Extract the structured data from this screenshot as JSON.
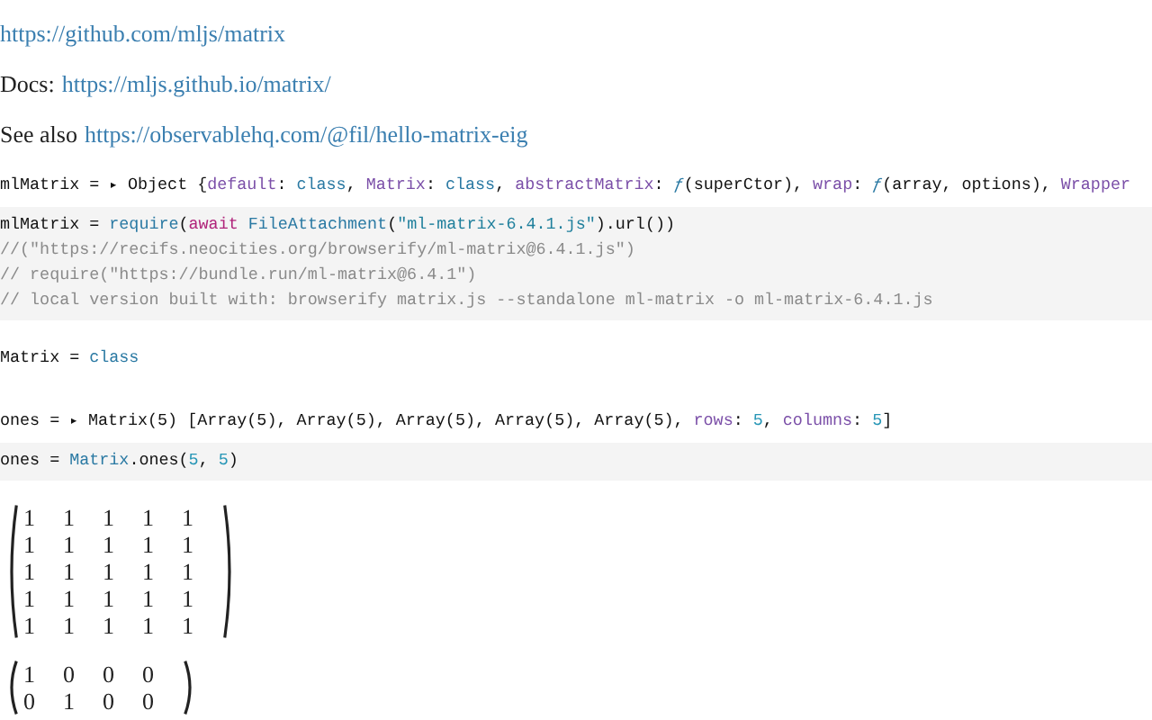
{
  "links": [
    {
      "url": "https://github.com/mljs/matrix"
    },
    {
      "prefix": "Docs:",
      "url": "https://mljs.github.io/matrix/"
    },
    {
      "prefix": "See also",
      "url": "https://observablehq.com/@fil/hello-matrix-eig"
    }
  ],
  "cells": [
    {
      "kind": "output",
      "tokens": [
        {
          "kind": "plain",
          "text": "mlMatrix = "
        },
        {
          "kind": "toggle",
          "text": "▸"
        },
        {
          "kind": "plain",
          "text": " Object {"
        },
        {
          "kind": "key",
          "text": "default"
        },
        {
          "kind": "plain",
          "text": ": "
        },
        {
          "kind": "value",
          "text": "class"
        },
        {
          "kind": "plain",
          "text": ", "
        },
        {
          "kind": "key",
          "text": "Matrix"
        },
        {
          "kind": "plain",
          "text": ": "
        },
        {
          "kind": "value",
          "text": "class"
        },
        {
          "kind": "plain",
          "text": ", "
        },
        {
          "kind": "key",
          "text": "abstractMatrix"
        },
        {
          "kind": "plain",
          "text": ": "
        },
        {
          "kind": "fn",
          "text": "ƒ"
        },
        {
          "kind": "plain",
          "text": "(superCtor), "
        },
        {
          "kind": "key",
          "text": "wrap"
        },
        {
          "kind": "plain",
          "text": ": "
        },
        {
          "kind": "fn",
          "text": "ƒ"
        },
        {
          "kind": "plain",
          "text": "(array, options), "
        },
        {
          "kind": "key",
          "text": "Wrapper"
        }
      ]
    },
    {
      "kind": "code",
      "lines": [
        [
          {
            "kind": "plain",
            "text": "mlMatrix = "
          },
          {
            "kind": "value",
            "text": "require"
          },
          {
            "kind": "plain",
            "text": "("
          },
          {
            "kind": "keyword",
            "text": "await"
          },
          {
            "kind": "value",
            "text": "FileAttachment"
          },
          {
            "kind": "plain",
            "text": "("
          },
          {
            "kind": "string",
            "text": "\"ml-matrix-6.4.1.js\""
          },
          {
            "kind": "plain",
            "text": ").url())"
          }
        ],
        [
          {
            "kind": "comment",
            "text": "//(\"https://recifs.neocities.org/browserify/ml-matrix@6.4.1.js\")"
          }
        ],
        [
          {
            "kind": "comment",
            "text": "// require(\"https://bundle.run/ml-matrix@6.4.1\")"
          }
        ],
        [
          {
            "kind": "comment",
            "text": "// local version built with: browserify matrix.js --standalone ml-matrix -o ml-matrix-6.4.1.js"
          }
        ]
      ]
    },
    {
      "kind": "output",
      "tokens": [
        {
          "kind": "plain",
          "text": "Matrix = "
        },
        {
          "kind": "value",
          "text": "class"
        }
      ]
    },
    {
      "kind": "output",
      "tokens": [
        {
          "kind": "plain",
          "text": "ones = "
        },
        {
          "kind": "toggle",
          "text": "▸"
        },
        {
          "kind": "plain",
          "text": " Matrix(5) [Array(5), Array(5), Array(5), Array(5), Array(5), "
        },
        {
          "kind": "key",
          "text": "rows"
        },
        {
          "kind": "plain",
          "text": ": "
        },
        {
          "kind": "number",
          "text": "5"
        },
        {
          "kind": "plain",
          "text": ", "
        },
        {
          "kind": "key",
          "text": "columns"
        },
        {
          "kind": "plain",
          "text": ": "
        },
        {
          "kind": "number",
          "text": "5"
        },
        {
          "kind": "plain",
          "text": "]"
        }
      ]
    },
    {
      "kind": "code",
      "lines": [
        [
          {
            "kind": "plain",
            "text": "ones = "
          },
          {
            "kind": "value",
            "text": "Matrix"
          },
          {
            "kind": "plain",
            "text": ".ones("
          },
          {
            "kind": "number",
            "text": "5"
          },
          {
            "kind": "plain",
            "text": ", "
          },
          {
            "kind": "number",
            "text": "5"
          },
          {
            "kind": "plain",
            "text": ")"
          }
        ]
      ]
    },
    {
      "kind": "matrix",
      "rows": [
        [
          "1",
          "1",
          "1",
          "1",
          "1"
        ],
        [
          "1",
          "1",
          "1",
          "1",
          "1"
        ],
        [
          "1",
          "1",
          "1",
          "1",
          "1"
        ],
        [
          "1",
          "1",
          "1",
          "1",
          "1"
        ],
        [
          "1",
          "1",
          "1",
          "1",
          "1"
        ]
      ]
    },
    {
      "kind": "matrix",
      "rows": [
        [
          "1",
          "0",
          "0",
          "0"
        ],
        [
          "0",
          "1",
          "0",
          "0"
        ]
      ]
    }
  ]
}
